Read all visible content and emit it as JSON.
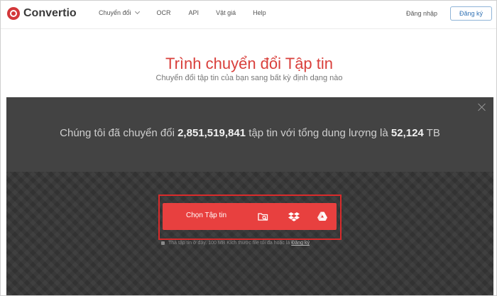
{
  "header": {
    "brand": "Convertio",
    "nav": [
      {
        "label": "Chuyển đổi",
        "has_dropdown": true
      },
      {
        "label": "OCR"
      },
      {
        "label": "API"
      },
      {
        "label": "Vật giá"
      },
      {
        "label": "Help"
      }
    ],
    "login_label": "Đăng nhập",
    "signup_label": "Đăng ký"
  },
  "hero": {
    "title": "Trình chuyển đổi Tập tin",
    "subtitle": "Chuyển đổi tập tin của bạn sang bất kỳ định dạng nào"
  },
  "stats": {
    "prefix": "Chúng tôi đã chuyển đổi ",
    "files_count": "2,851,519,841",
    "middle": " tập tin với tổng dung lượng là ",
    "total_size": "52,124",
    "unit": " TB"
  },
  "upload": {
    "choose_label": "Chọn Tập tin",
    "icons": [
      "folder-search-icon",
      "dropbox-icon",
      "google-drive-icon"
    ],
    "note": "Thả tập tin ở đây. 100 MB Kích thước file tối đa hoặc là ",
    "note_link": "Đăng ký"
  },
  "colors": {
    "accent": "#e8403f",
    "brand_title": "#d9403c",
    "panel": "#3f3f3f",
    "highlight": "#d92b2b"
  }
}
